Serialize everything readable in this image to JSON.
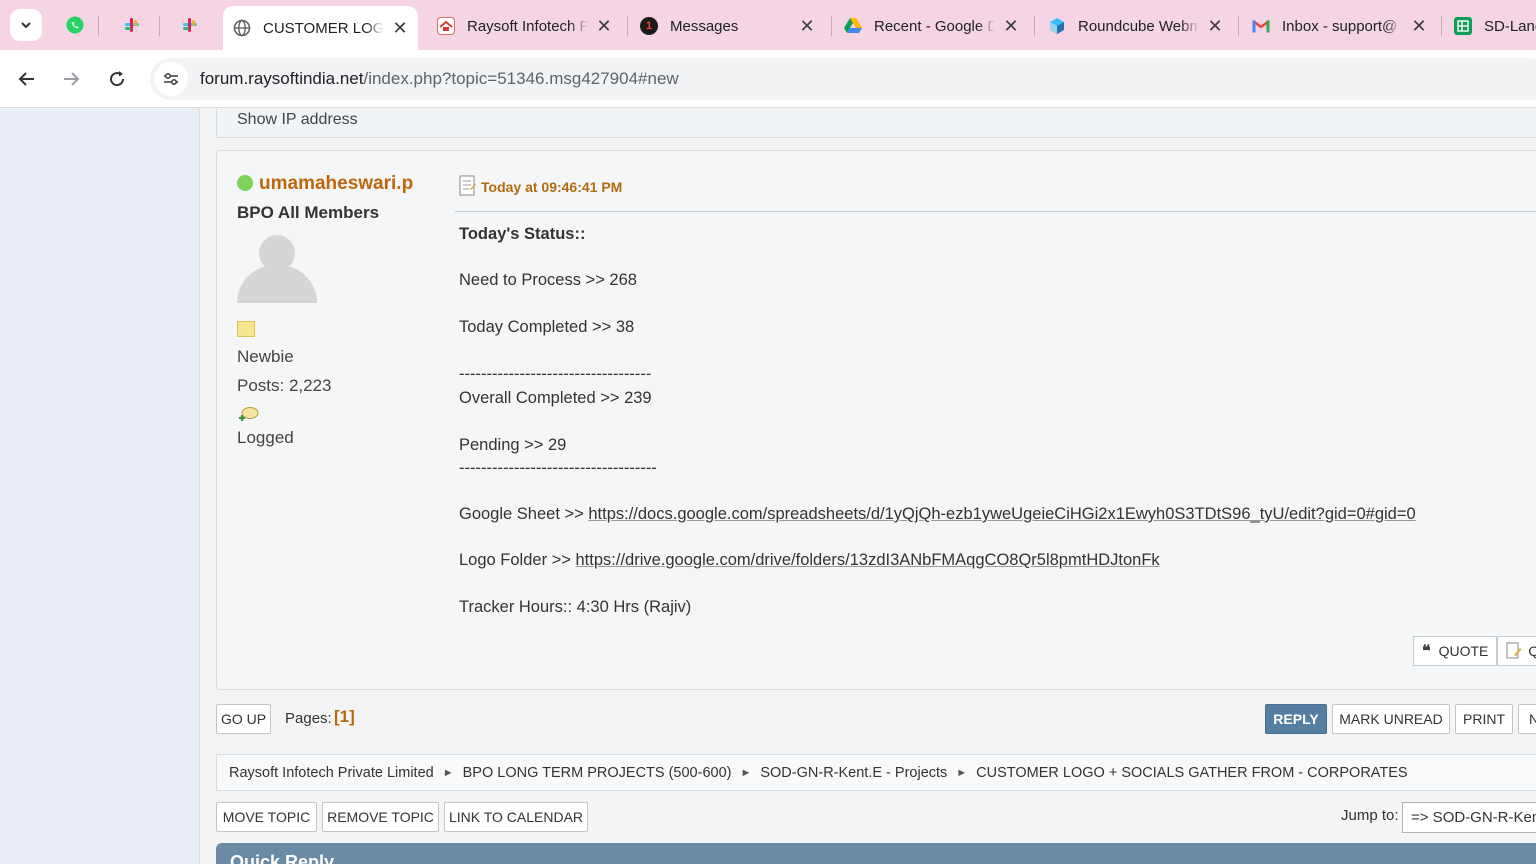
{
  "tabs": [
    {
      "title": "CUSTOMER LOGO + SOCIALS GATHER FROM - CORPORATES",
      "active": true,
      "icon": "globe-icon"
    },
    {
      "title": "Raysoft Infotech Private Limited",
      "active": false,
      "icon": "raysoft-icon"
    },
    {
      "title": "Messages",
      "active": false,
      "icon": "messages-icon"
    },
    {
      "title": "Recent - Google Drive",
      "active": false,
      "icon": "google-drive-icon"
    },
    {
      "title": "Roundcube Webmail",
      "active": false,
      "icon": "roundcube-icon"
    },
    {
      "title": "Inbox - support@",
      "active": false,
      "icon": "gmail-icon"
    },
    {
      "title": "SD-Lane",
      "active": false,
      "icon": "google-sheets-icon"
    }
  ],
  "address_bar": {
    "host": "forum.raysoftindia.net",
    "path": "/index.php?topic=51346.msg427904#new"
  },
  "prev_post": {
    "text": "Show IP address"
  },
  "post": {
    "author": "umamaheswari.p",
    "group": "BPO All Members",
    "rank": "Newbie",
    "posts": "Posts: 2,223",
    "logged": "Logged",
    "date": "Today at 09:46:41 PM",
    "status_heading": "Today's Status::",
    "need_to_process": "Need to Process >> 268",
    "today_completed": "Today Completed >> 38",
    "dashes_1": "-----------------------------------",
    "overall_completed": "Overall Completed >> 239",
    "pending": "Pending >> 29",
    "dashes_2": "------------------------------------",
    "google_sheet_label": "Google Sheet >> ",
    "google_sheet_url": "https://docs.google.com/spreadsheets/d/1yQjQh-ezb1yweUgeieCiHGi2x1Ewyh0S3TDtS96_tyU/edit?gid=0#gid=0",
    "logo_folder_label": "Logo Folder >> ",
    "logo_folder_url": "https://drive.google.com/drive/folders/13zdI3ANbFMAqgCO8Qr5l8pmtHDJtonFk",
    "tracker_hours": "Tracker Hours:: 4:30 Hrs (Rajiv)"
  },
  "post_buttons": {
    "quote": "QUOTE",
    "quick_edit": "Q"
  },
  "bottom_bar": {
    "go_up": "GO UP",
    "pages_label": "Pages:",
    "pages_current": "[1]",
    "reply": "REPLY",
    "mark_unread": "MARK UNREAD",
    "print": "PRINT",
    "notify": "N"
  },
  "linktree": [
    "Raysoft Infotech Private Limited",
    "BPO LONG TERM PROJECTS (500-600)",
    "SOD-GN-R-Kent.E - Projects",
    "CUSTOMER LOGO + SOCIALS GATHER FROM - CORPORATES"
  ],
  "moderation": {
    "move_topic": "MOVE TOPIC",
    "remove_topic": "REMOVE TOPIC",
    "link_to_calendar": "LINK TO CALENDAR"
  },
  "jump_to": {
    "label": "Jump to:",
    "value": "=> SOD-GN-R-Kent.E - Projects"
  },
  "quick_reply": {
    "title": "Quick Reply"
  },
  "colors": {
    "tabstrip": "#f5d5e4",
    "author": "#c0660d",
    "primary_button": "#557ea0",
    "quick_reply_bar": "#6a8aa6"
  }
}
